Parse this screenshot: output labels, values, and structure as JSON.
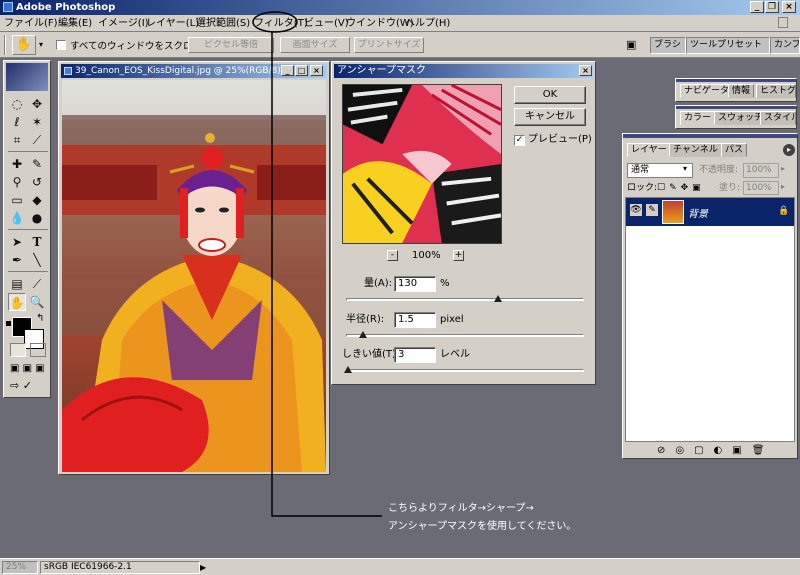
{
  "app": {
    "title": "Adobe Photoshop",
    "window_controls": {
      "minimize": "_",
      "restore": "❐",
      "close": "×"
    }
  },
  "menubar": {
    "items": [
      "ファイル(F)",
      "編集(E)",
      "イメージ(I)",
      "レイヤー(L)",
      "選択範囲(S)",
      "フィルタ(T)",
      "ビュー(V)",
      "ウインドウ(W)",
      "ヘルプ(H)"
    ],
    "highlighted": "フィルタ(T)"
  },
  "options": {
    "checkbox_label": "すべてのウィンドウをスクロール",
    "checkbox_checked": false,
    "buttons": [
      "ピクセル等倍",
      "画面サイズ",
      "プリントサイズ"
    ],
    "well_tabs": [
      "ブラシ",
      "ツールプリセット",
      "カンプ"
    ]
  },
  "document": {
    "title": "39_Canon_EOS_KissDigital.jpg @ 25%(RGB/8)"
  },
  "dialog": {
    "title": "アンシャープマスク",
    "ok_label": "OK",
    "cancel_label": "キャンセル",
    "preview_label": "プレビュー(P)",
    "preview_checked": true,
    "zoom": "100%",
    "zoom_out": "-",
    "zoom_in": "+",
    "amount": {
      "label": "量(A):",
      "value": "130",
      "unit": "%",
      "slider_fraction": 0.64
    },
    "radius": {
      "label": "半径(R):",
      "value": "1.5",
      "unit": "pixel",
      "slider_fraction": 0.07
    },
    "threshold": {
      "label": "しきい値(T):",
      "value": "3",
      "unit": "レベル",
      "slider_fraction": 0.01
    }
  },
  "palettes": {
    "navigator_tabs": [
      "ナビゲータ",
      "情報",
      "ヒストグラ"
    ],
    "color_tabs": [
      "カラー",
      "スウォッチ",
      "スタイル"
    ],
    "layers": {
      "tabs": [
        "レイヤー",
        "チャンネル",
        "パス"
      ],
      "blend_mode": "通常",
      "opacity_label": "不透明度:",
      "opacity_value": "100%",
      "lock_label": "ロック:",
      "fill_label": "塗り:",
      "fill_value": "100%",
      "layer_name": "背景"
    }
  },
  "status": {
    "zoom": "25%",
    "profile": "sRGB IEC61966-2.1"
  },
  "annotation": {
    "line1": "こちらよりフィルタ→シャープ→",
    "line2": "アンシャープマスクを使用してください。"
  },
  "colors": {
    "titlebar_start": "#0a246a",
    "titlebar_end": "#a6caf0",
    "chrome": "#d4d0c8",
    "workspace": "#6b6b75",
    "annotation_line": "#000000",
    "highlight_ellipse": "#000000"
  }
}
